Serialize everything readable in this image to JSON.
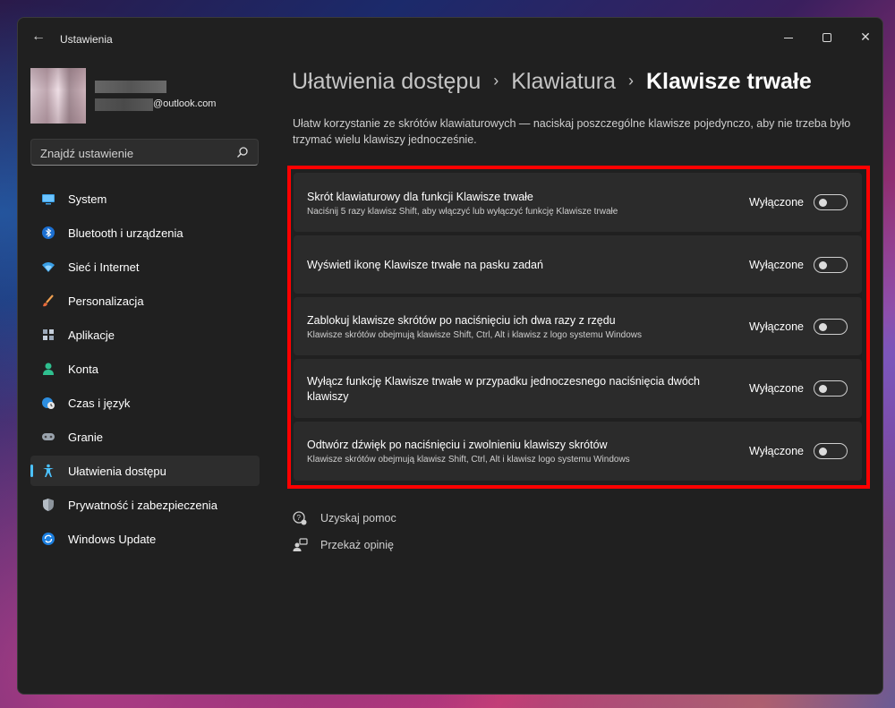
{
  "window": {
    "app_title": "Ustawienia",
    "back_glyph": "←",
    "close_glyph": "✕"
  },
  "profile": {
    "email_domain": "@outlook.com"
  },
  "search": {
    "placeholder": "Znajdź ustawienie"
  },
  "sidebar": {
    "items": [
      {
        "label": "System",
        "icon": "monitor-icon"
      },
      {
        "label": "Bluetooth i urządzenia",
        "icon": "bluetooth-icon"
      },
      {
        "label": "Sieć i Internet",
        "icon": "wifi-icon"
      },
      {
        "label": "Personalizacja",
        "icon": "brush-icon"
      },
      {
        "label": "Aplikacje",
        "icon": "apps-icon"
      },
      {
        "label": "Konta",
        "icon": "person-icon"
      },
      {
        "label": "Czas i język",
        "icon": "globe-clock-icon"
      },
      {
        "label": "Granie",
        "icon": "gamepad-icon"
      },
      {
        "label": "Ułatwienia dostępu",
        "icon": "accessibility-icon",
        "active": true
      },
      {
        "label": "Prywatność i zabezpieczenia",
        "icon": "shield-icon"
      },
      {
        "label": "Windows Update",
        "icon": "update-icon"
      }
    ]
  },
  "breadcrumb": {
    "items": [
      "Ułatwienia dostępu",
      "Klawiatura",
      "Klawisze trwałe"
    ],
    "separator": "›"
  },
  "description": "Ułatw korzystanie ze skrótów klawiaturowych — naciskaj poszczególne klawisze pojedynczo, aby nie trzeba było trzymać wielu klawiszy jednocześnie.",
  "settings": [
    {
      "title": "Skrót klawiaturowy dla funkcji Klawisze trwałe",
      "subtitle": "Naciśnij 5 razy klawisz Shift, aby włączyć lub wyłączyć funkcję Klawisze trwałe",
      "state": "Wyłączone",
      "on": false
    },
    {
      "title": "Wyświetl ikonę Klawisze trwałe na pasku zadań",
      "subtitle": "",
      "state": "Wyłączone",
      "on": false
    },
    {
      "title": "Zablokuj klawisze skrótów po naciśnięciu ich dwa razy z rzędu",
      "subtitle": "Klawisze skrótów obejmują klawisze Shift, Ctrl, Alt i klawisz z logo systemu Windows",
      "state": "Wyłączone",
      "on": false
    },
    {
      "title": "Wyłącz funkcję Klawisze trwałe w przypadku jednoczesnego naciśnięcia dwóch klawiszy",
      "subtitle": "",
      "state": "Wyłączone",
      "on": false
    },
    {
      "title": "Odtwórz dźwięk po naciśnięciu i zwolnieniu klawiszy skrótów",
      "subtitle": "Klawisze skrótów obejmują klawisz Shift, Ctrl, Alt i klawisz logo systemu Windows",
      "state": "Wyłączone",
      "on": false
    }
  ],
  "links": {
    "help": "Uzyskaj pomoc",
    "feedback": "Przekaż opinię"
  },
  "colors": {
    "accent": "#4cc2ff",
    "highlight_border": "#ff0000",
    "window_bg": "#202020",
    "card_bg": "#2b2b2b"
  }
}
